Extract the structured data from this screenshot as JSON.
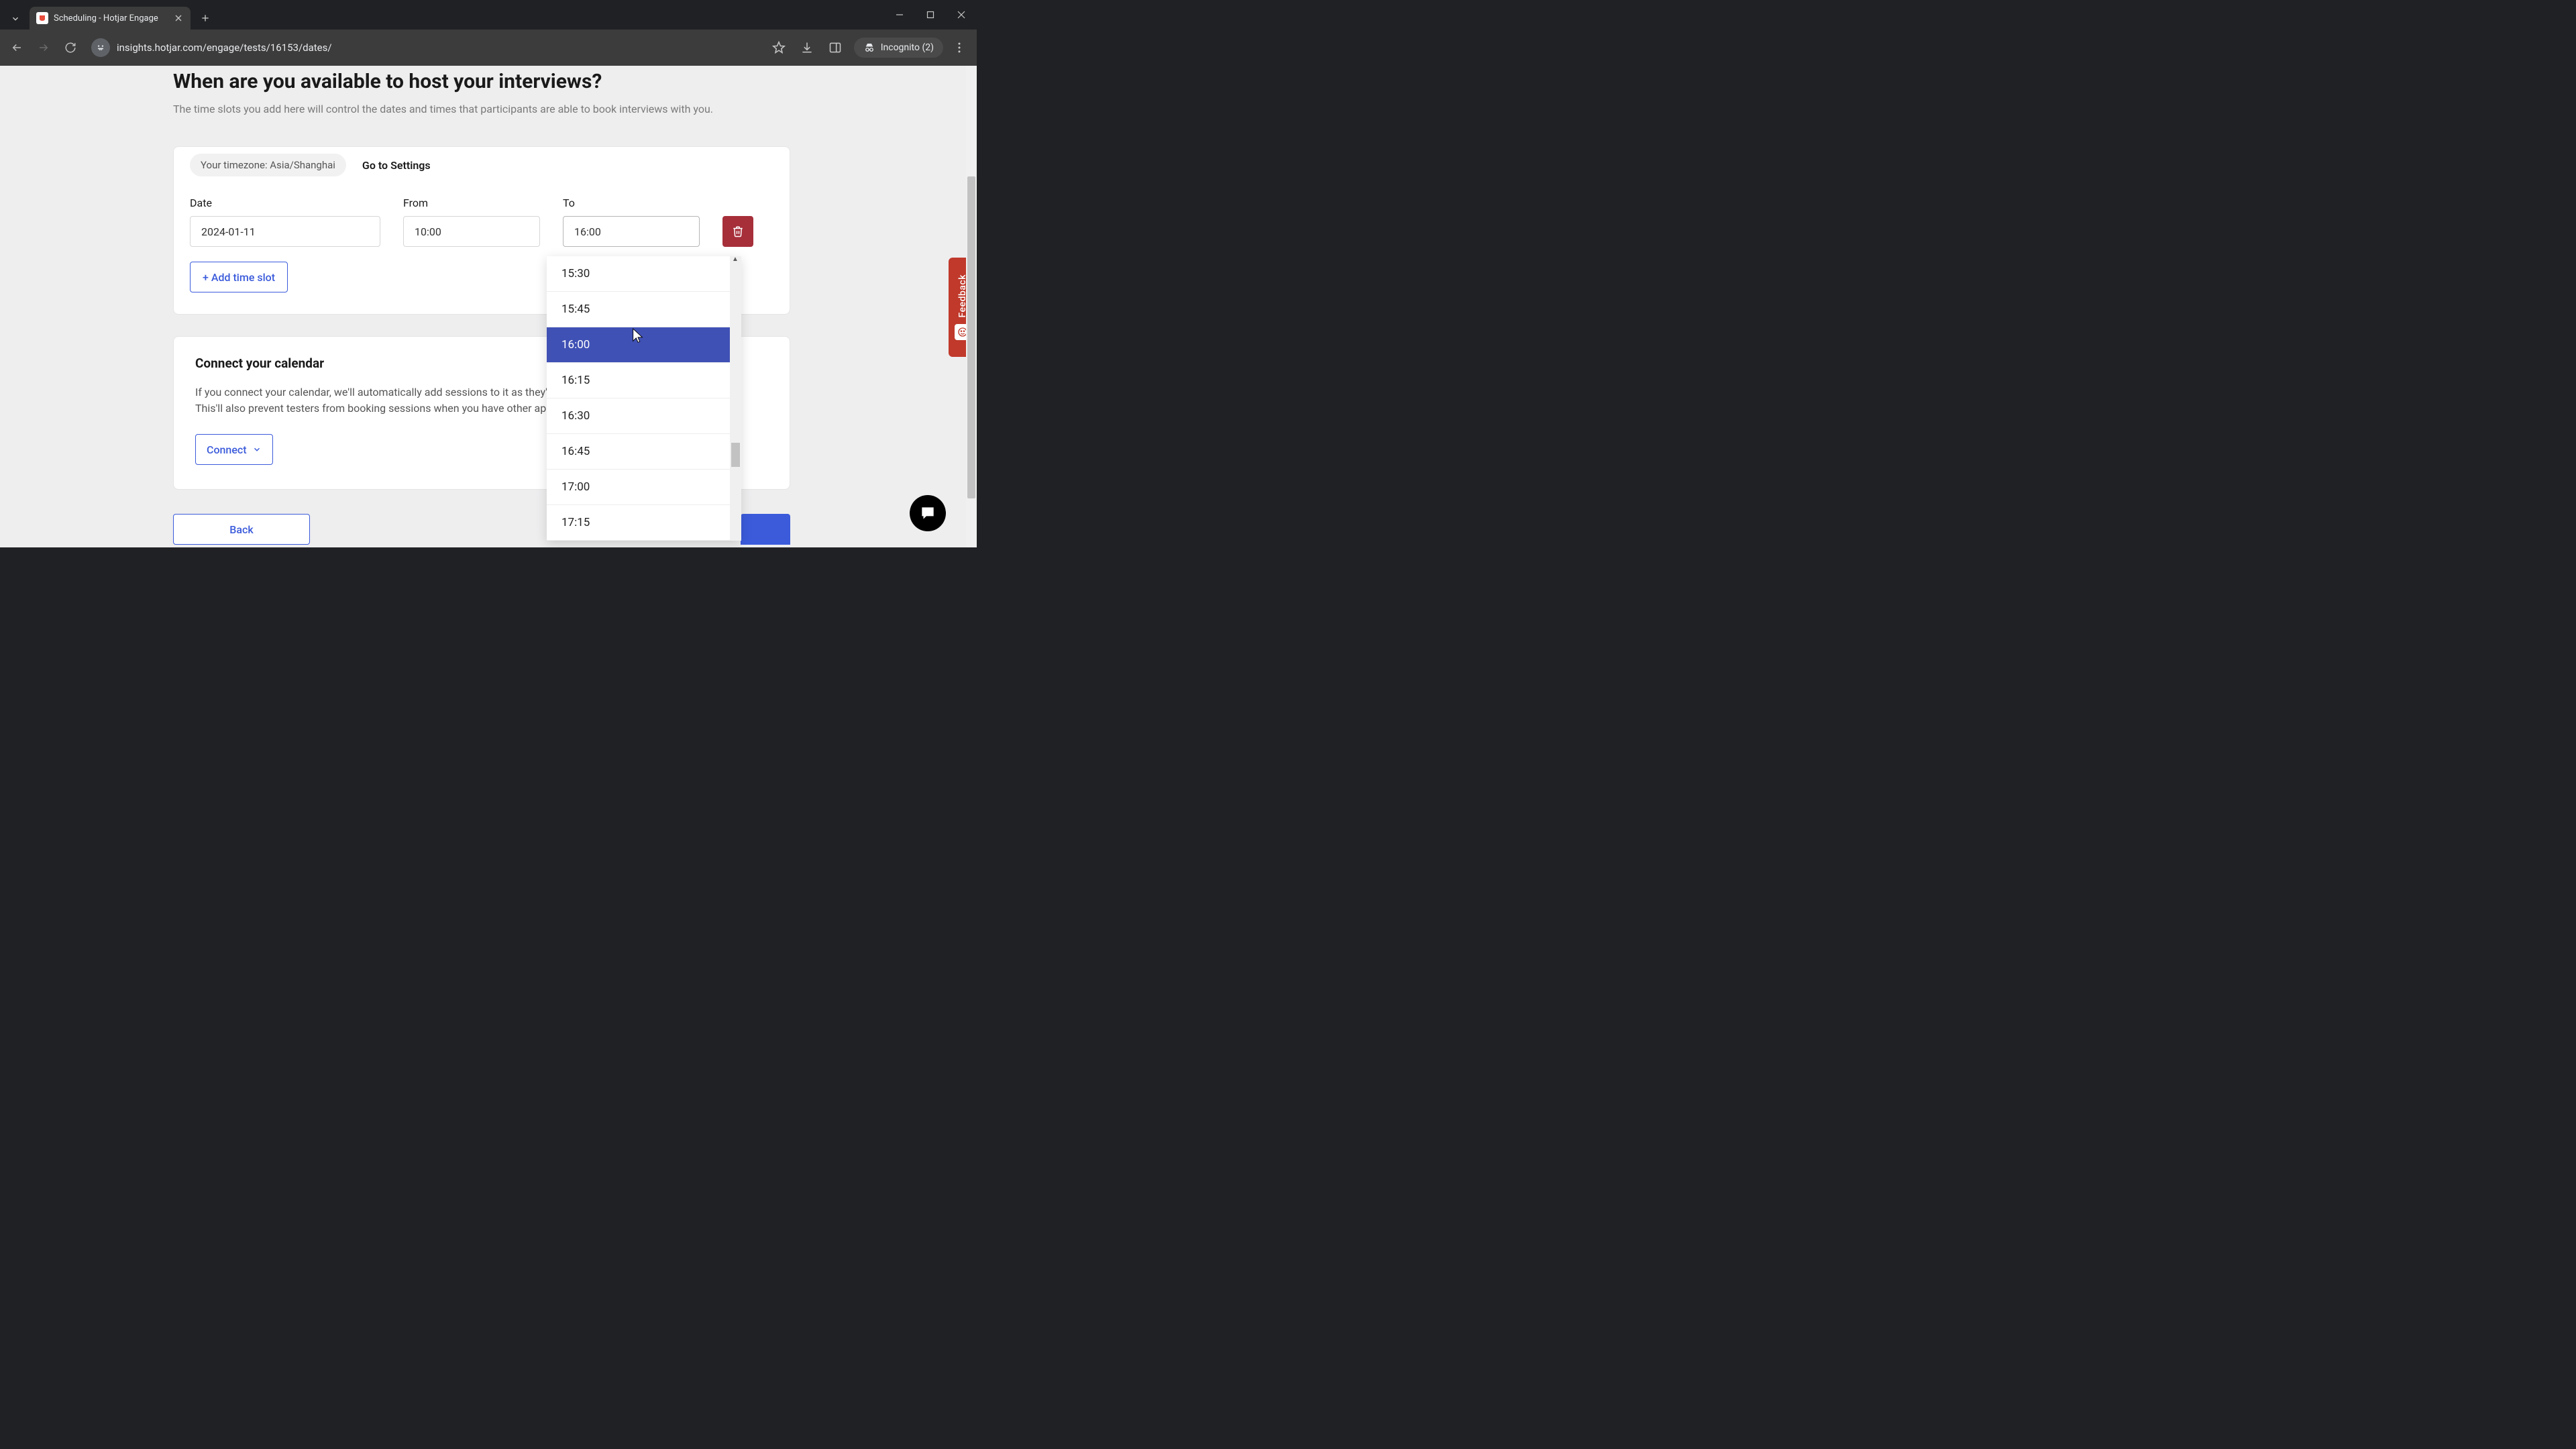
{
  "browser": {
    "tab_title": "Scheduling - Hotjar Engage",
    "url": "insights.hotjar.com/engage/tests/16153/dates/",
    "incognito_label": "Incognito (2)"
  },
  "page": {
    "heading": "When are you available to host your interviews?",
    "subheading": "The time slots you add here will control the dates and times that participants are able to book interviews with you.",
    "timezone_text": "Your timezone: Asia/Shanghai",
    "settings_link": "Go to Settings",
    "labels": {
      "date": "Date",
      "from": "From",
      "to": "To"
    },
    "slot": {
      "date": "2024-01-11",
      "from": "10:00",
      "to": "16:00"
    },
    "add_slot": "+ Add time slot",
    "calendar": {
      "title": "Connect your calendar",
      "body": "If you connect your calendar, we'll automatically add sessions to it as they're booked (as private events). This'll also prevent testers from booking sessions when you have other appointments.",
      "button": "Connect"
    },
    "back": "Back",
    "feedback": "Feedback"
  },
  "dropdown": {
    "options": [
      "15:30",
      "15:45",
      "16:00",
      "16:15",
      "16:30",
      "16:45",
      "17:00",
      "17:15"
    ],
    "selected": "16:00"
  }
}
